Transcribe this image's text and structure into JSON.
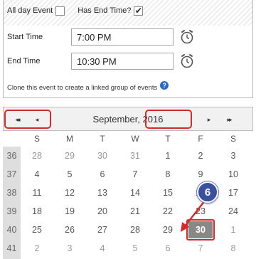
{
  "event": {
    "all_day_label": "All day Event",
    "has_end_time_label": "Has End Time?",
    "has_end_time_mark": "✔",
    "start_time_label": "Start Time",
    "start_time_value": "7:00 PM",
    "end_time_label": "End Time",
    "end_time_value": "10:30 PM",
    "clone_text": "Clone this event to create a linked group of events",
    "help_glyph": "?"
  },
  "calendar": {
    "month_label": "September, 2016",
    "nav": {
      "prev_year": "◂◂",
      "prev_month": "◂",
      "next_month": "▸",
      "next_year": "▸▸"
    },
    "weekdays": [
      "S",
      "M",
      "T",
      "W",
      "T",
      "F",
      "S"
    ],
    "weeks": [
      {
        "num": "36",
        "days": [
          "28",
          "29",
          "30",
          "31",
          "1",
          "2",
          "3"
        ]
      },
      {
        "num": "37",
        "days": [
          "4",
          "5",
          "6",
          "7",
          "8",
          "9",
          "10"
        ]
      },
      {
        "num": "38",
        "days": [
          "11",
          "12",
          "13",
          "14",
          "15",
          "16",
          "17"
        ]
      },
      {
        "num": "39",
        "days": [
          "18",
          "19",
          "20",
          "21",
          "22",
          "23",
          "24"
        ]
      },
      {
        "num": "40",
        "days": [
          "25",
          "26",
          "27",
          "28",
          "29",
          "30",
          "1"
        ]
      },
      {
        "num": "41",
        "days": [
          "2",
          "3",
          "4",
          "5",
          "6",
          "7",
          "8"
        ]
      }
    ],
    "selected_day": "30"
  },
  "callout": {
    "step_number": "6",
    "color": "#d62a2a",
    "badge_color": "#3a4fa0"
  }
}
